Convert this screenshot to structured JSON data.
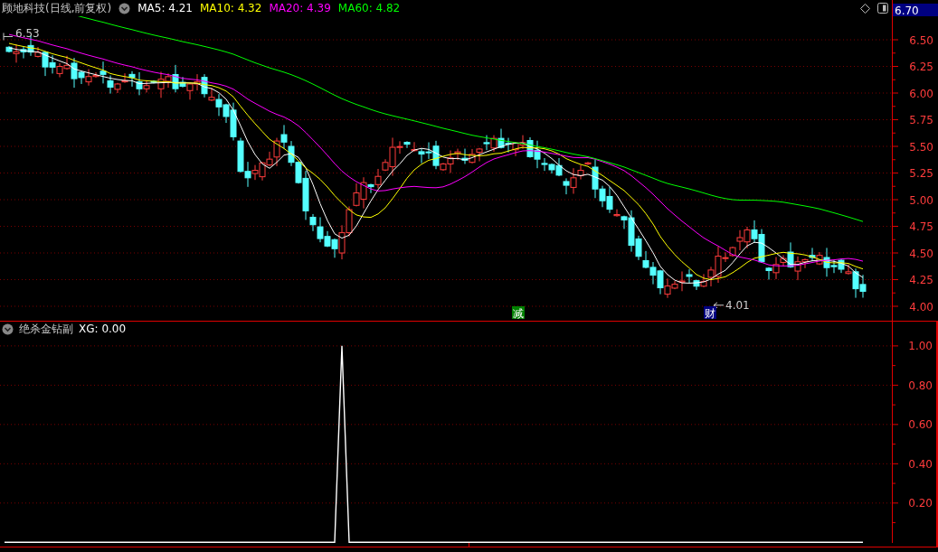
{
  "header": {
    "title": "顾地科技(日线,前复权)",
    "ma": [
      {
        "label": "MA5: 4.21",
        "color": "#ffffff"
      },
      {
        "label": "MA10: 4.32",
        "color": "#ffff00"
      },
      {
        "label": "MA20: 4.39",
        "color": "#ff00ff"
      },
      {
        "label": "MA60: 4.82",
        "color": "#00ff00"
      }
    ]
  },
  "price_axis": {
    "current": "6.70",
    "ticks": [
      "6.50",
      "6.25",
      "6.00",
      "5.75",
      "5.50",
      "5.25",
      "5.00",
      "4.75",
      "4.50",
      "4.25",
      "4.00"
    ]
  },
  "annotations": {
    "high": "6.53",
    "low": "4.01"
  },
  "signals": [
    {
      "label": "减",
      "color": "#008000"
    },
    {
      "label": "财",
      "color": "#000080"
    }
  ],
  "indicator": {
    "title": "绝杀金钻副",
    "reading": "XG: 0.00",
    "chart_data": {
      "type": "line",
      "grid": true,
      "ylim": [
        0,
        1.12
      ],
      "yticks": [
        {
          "value": 0.2,
          "label": "0.20"
        },
        {
          "value": 0.4,
          "label": "0.40"
        },
        {
          "value": 0.6,
          "label": "0.60"
        },
        {
          "value": 0.8,
          "label": "0.80"
        },
        {
          "value": 1,
          "label": "1.00"
        }
      ],
      "series": [
        {
          "color": "#ffffff",
          "values": [
            0,
            0,
            0,
            0,
            0,
            0,
            0,
            0,
            0,
            0,
            0,
            0,
            0,
            0,
            0,
            0,
            0,
            0,
            0,
            0,
            0,
            0,
            0,
            0,
            0,
            0,
            0,
            0,
            0,
            0,
            0,
            0,
            0,
            0,
            0,
            0,
            0,
            0,
            0,
            0,
            0,
            0,
            0,
            0,
            0,
            0,
            1,
            0,
            0,
            0,
            0,
            0,
            0,
            0,
            0,
            0,
            0,
            0,
            0,
            0,
            0,
            0,
            0,
            0,
            0,
            0,
            0,
            0,
            0,
            0,
            0,
            0,
            0,
            0,
            0,
            0,
            0,
            0,
            0,
            0,
            0,
            0,
            0,
            0,
            0,
            0,
            0,
            0,
            0,
            0,
            0,
            0,
            0,
            0,
            0,
            0,
            0,
            0,
            0,
            0,
            0,
            0,
            0,
            0,
            0,
            0,
            0,
            0,
            0,
            0,
            0,
            0,
            0,
            0,
            0,
            0,
            0,
            0,
            0
          ]
        }
      ]
    }
  }
}
